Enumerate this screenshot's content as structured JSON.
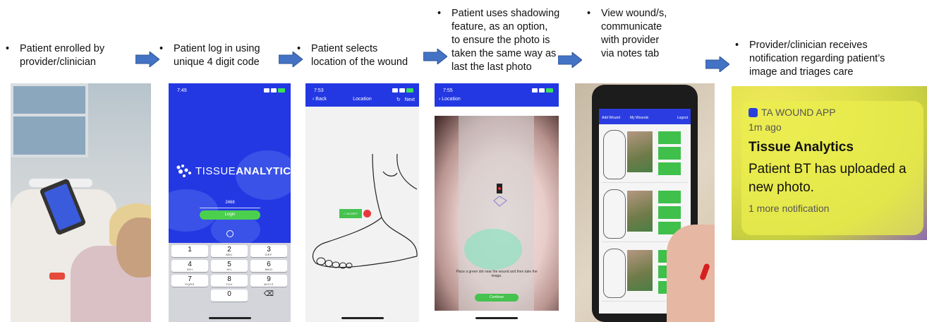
{
  "steps": [
    {
      "text": "Patient enrolled by\nprovider/clinician"
    },
    {
      "text": "Patient log in using\nunique 4 digit code"
    },
    {
      "text": "Patient selects\nlocation of the wound"
    },
    {
      "text": "Patient uses shadowing\nfeature, as an option,\nto ensure the photo is\ntaken the same way as\nlast the last photo"
    },
    {
      "text": "View wound/s,\ncommunicate\nwith provider\nvia notes tab"
    },
    {
      "text": "Provider/clinician receives\nnotification regarding patient’s\nimage and triages care"
    }
  ],
  "bullet": "•",
  "colors": {
    "arrow": "#4472c4",
    "app_blue": "#2338e3",
    "accept_green": "#46c24e",
    "dot_red": "#e8383c"
  },
  "login_screen": {
    "time": "7:49",
    "brand_light": "TISSUE",
    "brand_bold": "ANALYTICS",
    "code_value": "2468",
    "login_label": "Login",
    "keys": [
      {
        "n": "1",
        "l": ""
      },
      {
        "n": "2",
        "l": "ABC"
      },
      {
        "n": "3",
        "l": "DEF"
      },
      {
        "n": "4",
        "l": "GHI"
      },
      {
        "n": "5",
        "l": "JKL"
      },
      {
        "n": "6",
        "l": "MNO"
      },
      {
        "n": "7",
        "l": "PQRS"
      },
      {
        "n": "8",
        "l": "TUV"
      },
      {
        "n": "9",
        "l": "WXYZ"
      },
      {
        "n": "",
        "l": ""
      },
      {
        "n": "0",
        "l": ""
      },
      {
        "n": "⌫",
        "l": ""
      }
    ]
  },
  "location_screen": {
    "time": "7:53",
    "back_label": "‹ Back",
    "title": "Location",
    "next_label": "Next",
    "accept_label": "✓ ACCEPT"
  },
  "camera_screen": {
    "time": "7:55",
    "back_label": "‹ Location",
    "instruction": "Place a green dot near the wound and then take the image.",
    "continue_label": "Continue"
  },
  "wounds_screen": {
    "add_label": "Add Wound",
    "my_label": "My Wounds",
    "logout_label": "Logout"
  },
  "notification": {
    "app_name": "TA WOUND APP",
    "time_ago": "1m ago",
    "title": "Tissue Analytics",
    "body": "Patient BT has uploaded a new photo.",
    "more": "1 more notification"
  }
}
